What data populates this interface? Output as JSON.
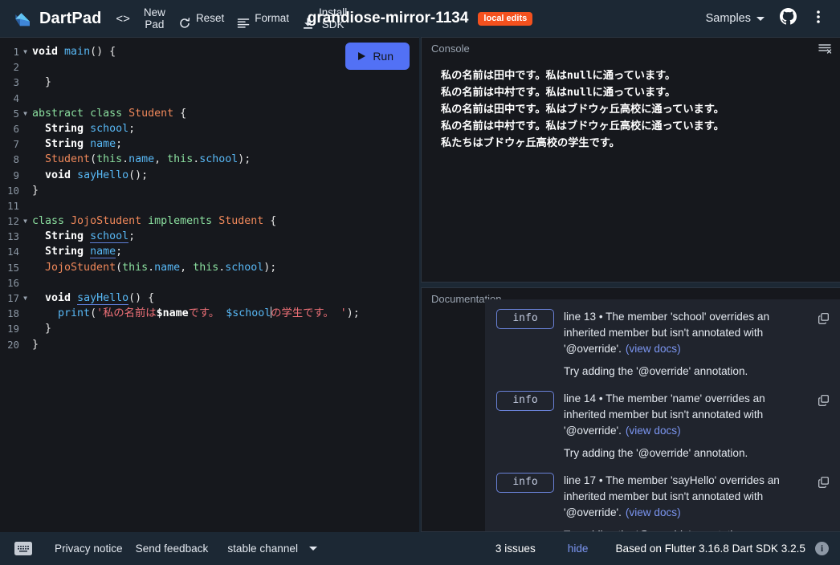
{
  "header": {
    "brand": "DartPad",
    "code_icon": "<>",
    "toolbar": [
      {
        "label": "New\nPad",
        "icon": "none",
        "name": "new-pad"
      },
      {
        "label": "Reset",
        "icon": "refresh-icon",
        "name": "reset"
      },
      {
        "label": "Format",
        "icon": "format-lines-icon",
        "name": "format"
      },
      {
        "label": "Install\nSDK",
        "icon": "download-icon",
        "name": "install-sdk"
      }
    ],
    "doc_title": "grandiose-mirror-1134",
    "local_edits_badge": "local edits",
    "samples_label": "Samples",
    "github_icon": "github-icon",
    "overflow_icon": "more-vertical-icon"
  },
  "editor": {
    "run_label": "Run",
    "lines": [
      {
        "n": 1,
        "fold": true,
        "tokens": [
          {
            "t": "void",
            "c": "kw"
          },
          {
            "t": " ",
            "c": "punc"
          },
          {
            "t": "main",
            "c": "ident"
          },
          {
            "t": "() {",
            "c": "punc"
          }
        ]
      },
      {
        "n": 2,
        "fold": false,
        "tokens": []
      },
      {
        "n": 3,
        "fold": false,
        "tokens": [
          {
            "t": "  }",
            "c": "punc"
          }
        ]
      },
      {
        "n": 4,
        "fold": false,
        "tokens": []
      },
      {
        "n": 5,
        "fold": true,
        "tokens": [
          {
            "t": "abstract",
            "c": "kw2"
          },
          {
            "t": " ",
            "c": "punc"
          },
          {
            "t": "class",
            "c": "kw2"
          },
          {
            "t": " ",
            "c": "punc"
          },
          {
            "t": "Student",
            "c": "typ"
          },
          {
            "t": " {",
            "c": "punc"
          }
        ]
      },
      {
        "n": 6,
        "fold": false,
        "tokens": [
          {
            "t": "  ",
            "c": "punc"
          },
          {
            "t": "String",
            "c": "kw"
          },
          {
            "t": " ",
            "c": "punc"
          },
          {
            "t": "school",
            "c": "ident"
          },
          {
            "t": ";",
            "c": "punc"
          }
        ]
      },
      {
        "n": 7,
        "fold": false,
        "tokens": [
          {
            "t": "  ",
            "c": "punc"
          },
          {
            "t": "String",
            "c": "kw"
          },
          {
            "t": " ",
            "c": "punc"
          },
          {
            "t": "name",
            "c": "ident"
          },
          {
            "t": ";",
            "c": "punc"
          }
        ]
      },
      {
        "n": 8,
        "fold": false,
        "tokens": [
          {
            "t": "  ",
            "c": "punc"
          },
          {
            "t": "Student",
            "c": "typ"
          },
          {
            "t": "(",
            "c": "punc"
          },
          {
            "t": "this",
            "c": "this"
          },
          {
            "t": ".",
            "c": "punc"
          },
          {
            "t": "name",
            "c": "ident"
          },
          {
            "t": ", ",
            "c": "punc"
          },
          {
            "t": "this",
            "c": "this"
          },
          {
            "t": ".",
            "c": "punc"
          },
          {
            "t": "school",
            "c": "ident"
          },
          {
            "t": ");",
            "c": "punc"
          }
        ]
      },
      {
        "n": 9,
        "fold": false,
        "tokens": [
          {
            "t": "  ",
            "c": "punc"
          },
          {
            "t": "void",
            "c": "kw"
          },
          {
            "t": " ",
            "c": "punc"
          },
          {
            "t": "sayHello",
            "c": "ident"
          },
          {
            "t": "();",
            "c": "punc"
          }
        ]
      },
      {
        "n": 10,
        "fold": false,
        "tokens": [
          {
            "t": "}",
            "c": "punc"
          }
        ]
      },
      {
        "n": 11,
        "fold": false,
        "tokens": []
      },
      {
        "n": 12,
        "fold": true,
        "tokens": [
          {
            "t": "class",
            "c": "kw2"
          },
          {
            "t": " ",
            "c": "punc"
          },
          {
            "t": "JojoStudent",
            "c": "typ"
          },
          {
            "t": " ",
            "c": "punc"
          },
          {
            "t": "implements",
            "c": "kw2"
          },
          {
            "t": " ",
            "c": "punc"
          },
          {
            "t": "Student",
            "c": "typ"
          },
          {
            "t": " {",
            "c": "punc"
          }
        ]
      },
      {
        "n": 13,
        "fold": false,
        "tokens": [
          {
            "t": "  ",
            "c": "punc"
          },
          {
            "t": "String",
            "c": "kw"
          },
          {
            "t": " ",
            "c": "punc"
          },
          {
            "t": "school",
            "c": "ident squig"
          },
          {
            "t": ";",
            "c": "punc"
          }
        ]
      },
      {
        "n": 14,
        "fold": false,
        "tokens": [
          {
            "t": "  ",
            "c": "punc"
          },
          {
            "t": "String",
            "c": "kw"
          },
          {
            "t": " ",
            "c": "punc"
          },
          {
            "t": "name",
            "c": "ident squig"
          },
          {
            "t": ";",
            "c": "punc"
          }
        ]
      },
      {
        "n": 15,
        "fold": false,
        "tokens": [
          {
            "t": "  ",
            "c": "punc"
          },
          {
            "t": "JojoStudent",
            "c": "typ"
          },
          {
            "t": "(",
            "c": "punc"
          },
          {
            "t": "this",
            "c": "this"
          },
          {
            "t": ".",
            "c": "punc"
          },
          {
            "t": "name",
            "c": "ident"
          },
          {
            "t": ", ",
            "c": "punc"
          },
          {
            "t": "this",
            "c": "this"
          },
          {
            "t": ".",
            "c": "punc"
          },
          {
            "t": "school",
            "c": "ident"
          },
          {
            "t": ");",
            "c": "punc"
          }
        ]
      },
      {
        "n": 16,
        "fold": false,
        "tokens": []
      },
      {
        "n": 17,
        "fold": true,
        "tokens": [
          {
            "t": "  ",
            "c": "punc"
          },
          {
            "t": "void",
            "c": "kw"
          },
          {
            "t": " ",
            "c": "punc"
          },
          {
            "t": "sayHello",
            "c": "ident squig"
          },
          {
            "t": "() {",
            "c": "punc"
          }
        ]
      },
      {
        "n": 18,
        "fold": false,
        "tokens": [
          {
            "t": "    ",
            "c": "punc"
          },
          {
            "t": "print",
            "c": "ident"
          },
          {
            "t": "(",
            "c": "punc"
          },
          {
            "t": "'私の名前は",
            "c": "str"
          },
          {
            "t": "$name",
            "c": "interp"
          },
          {
            "t": "です。 ",
            "c": "str"
          },
          {
            "t": "$school",
            "c": "interp2"
          },
          {
            "t": "CARET",
            "c": "caret"
          },
          {
            "t": "の学生です。 '",
            "c": "str"
          },
          {
            "t": ");",
            "c": "punc"
          }
        ]
      },
      {
        "n": 19,
        "fold": false,
        "tokens": [
          {
            "t": "  }",
            "c": "punc"
          }
        ]
      },
      {
        "n": 20,
        "fold": false,
        "tokens": [
          {
            "t": "}",
            "c": "punc"
          }
        ]
      }
    ]
  },
  "console": {
    "title": "Console",
    "clear_icon": "clear-console-icon",
    "output": [
      "私の名前は田中です。私はnullに通っています。",
      "私の名前は中村です。私はnullに通っています。",
      "私の名前は田中です。私はブドウヶ丘高校に通っています。",
      "私の名前は中村です。私はブドウヶ丘高校に通っています。",
      "私たちはブドウヶ丘高校の学生です。"
    ]
  },
  "documentation": {
    "title": "Documentation"
  },
  "issues": {
    "items": [
      {
        "severity": "info",
        "message": "line 13 • The member 'school' overrides an inherited member but isn't annotated with '@override'.",
        "view_docs": "(view docs)",
        "fix": "Try adding the '@override' annotation.",
        "copy_icon": "copy-icon"
      },
      {
        "severity": "info",
        "message": "line 14 • The member 'name' overrides an inherited member but isn't annotated with '@override'.",
        "view_docs": "(view docs)",
        "fix": "Try adding the '@override' annotation.",
        "copy_icon": "copy-icon"
      },
      {
        "severity": "info",
        "message": "line 17 • The member 'sayHello' overrides an inherited member but isn't annotated with '@override'.",
        "view_docs": "(view docs)",
        "fix": "Try adding the '@override' annotation.",
        "copy_icon": "copy-icon"
      }
    ]
  },
  "footer": {
    "keyboard_icon": "keyboard-icon",
    "privacy_notice": "Privacy notice",
    "send_feedback": "Send feedback",
    "channel": "stable channel",
    "issues_count": "3 issues",
    "hide_label": "hide",
    "version": "Based on Flutter 3.16.8 Dart SDK 3.2.5",
    "info_icon": "info-icon"
  },
  "colors": {
    "accent_run": "#5271f5",
    "badge_local_edits": "#f4511e",
    "link": "#7b95f0",
    "header_bg": "#1c2834",
    "editor_bg": "#16181d",
    "panel_bg": "#20242d"
  }
}
